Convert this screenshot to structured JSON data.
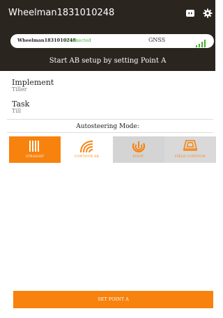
{
  "app": {
    "title": "Wheelman1831010248"
  },
  "status": {
    "device": "Wheelman1831010248",
    "connection": "- Connected",
    "gnss_label": "GNSS"
  },
  "prompt": "Start AB setup by setting Point A",
  "implement": {
    "title": "Implement",
    "value": "Tiller"
  },
  "task": {
    "title": "Task",
    "value": "Till"
  },
  "autosteer": {
    "label": "Autosteering Mode:",
    "modes": [
      {
        "label": "STRAIGHT",
        "selected": true
      },
      {
        "label": "CONTOUR AB",
        "selected": false
      },
      {
        "label": "PIVOT",
        "selected": false
      },
      {
        "label": "FIELD CONTOUR",
        "selected": false
      }
    ]
  },
  "actions": {
    "set_point": "SET POINT A"
  },
  "colors": {
    "accent": "#f7820d",
    "header": "#2b2520",
    "connected": "#3cae3c"
  },
  "icons": [
    "switch-view-icon",
    "gear-icon",
    "signal-bars-icon",
    "straight-lines-icon",
    "contour-lines-icon",
    "pivot-icon",
    "field-contour-icon"
  ]
}
